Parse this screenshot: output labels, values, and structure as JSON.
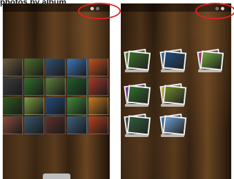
{
  "caption": "photos by album",
  "left_screen": {
    "view": "grid",
    "status_text": "",
    "toggle_icons": [
      "grid-view-icon",
      "album-view-icon"
    ],
    "thumbnail_colors": [
      "#6b5a3e",
      "#4c6f2a",
      "#2f4f6f",
      "#3a76b8",
      "#c2501e",
      "#3b3b3b",
      "#2e6e2b",
      "#5a7f3a",
      "#1f5e2a",
      "#a6392a",
      "#2d5a1e",
      "#7b9b3f",
      "#244a7a",
      "#3f8a3a",
      "#c97a1e",
      "#8a4b3a",
      "#35566f",
      "#5e2f2a",
      "#3b5f7f",
      "#b8401f"
    ]
  },
  "right_screen": {
    "view": "albums",
    "status_text": "",
    "toggle_icons": [
      "grid-view-icon",
      "album-view-icon"
    ],
    "album_stacks": [
      {
        "colors": [
          "#5f8c3a",
          "#3a6f2a"
        ]
      },
      {
        "colors": [
          "#3a6fa8",
          "#1f4f7f"
        ]
      },
      {
        "colors": [
          "#c03a7a",
          "#6fa83a"
        ]
      },
      {
        "colors": [
          "#8a3aa8",
          "#2f6f2a"
        ]
      },
      {
        "colors": [
          "#d9c23a",
          "#6f8c2a"
        ]
      },
      {
        "colors": [
          "#4a4a4a",
          "#2f5f3a"
        ]
      },
      {
        "colors": [
          "#3a7fbf",
          "#6fa0d0"
        ]
      }
    ]
  },
  "accent_color": "#e02020"
}
